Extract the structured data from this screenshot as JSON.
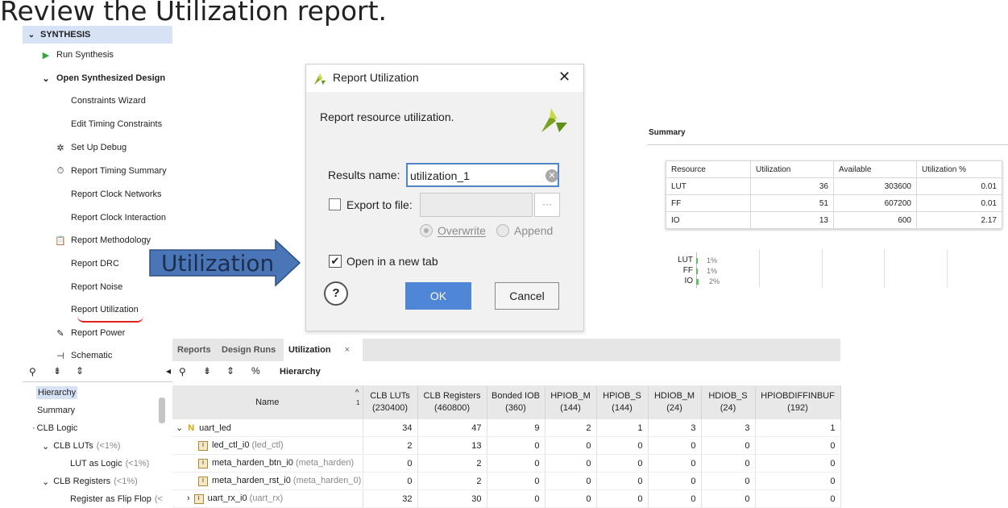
{
  "instruction": "Review the Utilization report.",
  "flow_navigator": {
    "section": "SYNTHESIS",
    "items": [
      {
        "label": "Run Synthesis",
        "icon": "play-icon"
      },
      {
        "label": "Open Synthesized Design",
        "icon": "chevron-down-icon"
      },
      {
        "label": "Constraints Wizard",
        "icon": ""
      },
      {
        "label": "Edit Timing Constraints",
        "icon": ""
      },
      {
        "label": "Set Up Debug",
        "icon": "bug-icon"
      },
      {
        "label": "Report Timing Summary",
        "icon": "clock-icon"
      },
      {
        "label": "Report Clock Networks",
        "icon": ""
      },
      {
        "label": "Report Clock Interaction",
        "icon": ""
      },
      {
        "label": "Report Methodology",
        "icon": "clipboard-icon"
      },
      {
        "label": "Report DRC",
        "icon": ""
      },
      {
        "label": "Report Noise",
        "icon": ""
      },
      {
        "label": "Report Utilization",
        "icon": ""
      },
      {
        "label": "Report Power",
        "icon": "power-icon"
      },
      {
        "label": "Schematic",
        "icon": "schematic-icon"
      }
    ]
  },
  "callout": {
    "label": "Utilization"
  },
  "dialog": {
    "title": "Report Utilization",
    "description": "Report resource utilization.",
    "results_name_label": "Results name:",
    "results_name_value": "utilization_1",
    "export_label": "Export to file:",
    "export_value": "",
    "dots": "···",
    "overwrite_label": "Overwrite",
    "append_label": "Append",
    "open_new_tab_label": "Open in a new tab",
    "open_new_tab_checked": true,
    "help": "?",
    "ok": "OK",
    "cancel": "Cancel",
    "close": "✕"
  },
  "summary": {
    "title": "Summary",
    "headers": [
      "Resource",
      "Utilization",
      "Available",
      "Utilization %"
    ],
    "rows": [
      [
        "LUT",
        "36",
        "303600",
        "0.01"
      ],
      [
        "FF",
        "51",
        "607200",
        "0.01"
      ],
      [
        "IO",
        "13",
        "600",
        "2.17"
      ]
    ],
    "bars": [
      {
        "label": "LUT",
        "pct": "1%",
        "value": 0.01
      },
      {
        "label": "FF",
        "pct": "1%",
        "value": 0.01
      },
      {
        "label": "IO",
        "pct": "2%",
        "value": 0.0217
      }
    ]
  },
  "tabs": [
    {
      "label": "Reports",
      "active": false
    },
    {
      "label": "Design Runs",
      "active": false
    },
    {
      "label": "Utilization",
      "active": true,
      "close": "×"
    }
  ],
  "toolbar": {
    "percent": "%",
    "hierarchy": "Hierarchy"
  },
  "left_tree": [
    {
      "label": "Hierarchy",
      "suffix": "",
      "selected": true
    },
    {
      "label": "Summary",
      "suffix": ""
    },
    {
      "label": "CLB Logic",
      "suffix": ""
    },
    {
      "label": "CLB LUTs",
      "suffix": "(<1%)"
    },
    {
      "label": "LUT as Logic",
      "suffix": "(<1%)"
    },
    {
      "label": "CLB Registers",
      "suffix": "(<1%)"
    },
    {
      "label": "Register as Flip Flop",
      "suffix": "(<"
    }
  ],
  "hierarchy_table": {
    "headers": [
      {
        "l1": "Name",
        "l2": ""
      },
      {
        "l1": "CLB LUTs",
        "l2": "(230400)"
      },
      {
        "l1": "CLB Registers",
        "l2": "(460800)"
      },
      {
        "l1": "Bonded IOB",
        "l2": "(360)"
      },
      {
        "l1": "HPIOB_M",
        "l2": "(144)"
      },
      {
        "l1": "HPIOB_S",
        "l2": "(144)"
      },
      {
        "l1": "HDIOB_M",
        "l2": "(24)"
      },
      {
        "l1": "HDIOB_S",
        "l2": "(24)"
      },
      {
        "l1": "HPIOBDIFFINBUF",
        "l2": "(192)"
      }
    ],
    "sort_mark": "1",
    "rows": [
      {
        "name": "uart_led",
        "sub": "",
        "values": [
          "34",
          "47",
          "9",
          "2",
          "1",
          "3",
          "3",
          "1"
        ]
      },
      {
        "name": "led_ctl_i0",
        "sub": "(led_ctl)",
        "values": [
          "2",
          "13",
          "0",
          "0",
          "0",
          "0",
          "0",
          "0"
        ]
      },
      {
        "name": "meta_harden_btn_i0",
        "sub": "(meta_harden)",
        "values": [
          "0",
          "2",
          "0",
          "0",
          "0",
          "0",
          "0",
          "0"
        ]
      },
      {
        "name": "meta_harden_rst_i0",
        "sub": "(meta_harden_0)",
        "values": [
          "0",
          "2",
          "0",
          "0",
          "0",
          "0",
          "0",
          "0"
        ]
      },
      {
        "name": "uart_rx_i0",
        "sub": "(uart_rx)",
        "values": [
          "32",
          "30",
          "0",
          "0",
          "0",
          "0",
          "0",
          "0"
        ]
      }
    ]
  }
}
